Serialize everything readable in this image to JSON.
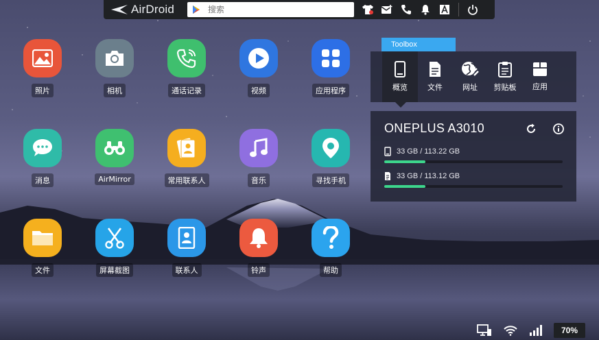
{
  "topbar": {
    "logo_text": "AirDroid",
    "search_placeholder": "搜索",
    "icons": [
      "tshirt-icon",
      "mail-icon",
      "phone-icon",
      "bell-icon",
      "font-icon",
      "power-icon"
    ]
  },
  "apps": [
    {
      "label": "照片",
      "icon": "photos-icon",
      "color": "#e8553a"
    },
    {
      "label": "相机",
      "icon": "camera-icon",
      "color": "#6b7f8c"
    },
    {
      "label": "通话记录",
      "icon": "call-log-icon",
      "color": "#3fbf6e"
    },
    {
      "label": "视频",
      "icon": "video-icon",
      "color": "#2f76e0"
    },
    {
      "label": "应用程序",
      "icon": "apps-icon",
      "color": "#2d6fe6"
    },
    {
      "label": "消息",
      "icon": "message-icon",
      "color": "#2fbba8"
    },
    {
      "label": "AirMirror",
      "icon": "binoculars-icon",
      "color": "#3fc070"
    },
    {
      "label": "常用联系人",
      "icon": "frequent-contacts-icon",
      "color": "#f5ae1f"
    },
    {
      "label": "音乐",
      "icon": "music-icon",
      "color": "#8f6fe0"
    },
    {
      "label": "寻找手机",
      "icon": "location-pin-icon",
      "color": "#26b7b0"
    },
    {
      "label": "文件",
      "icon": "folder-icon",
      "color": "#f5b01e"
    },
    {
      "label": "屏幕截图",
      "icon": "scissors-icon",
      "color": "#26a4e8"
    },
    {
      "label": "联系人",
      "icon": "contacts-icon",
      "color": "#2b97e8"
    },
    {
      "label": "铃声",
      "icon": "ringtone-bell-icon",
      "color": "#ec5a3f"
    },
    {
      "label": "帮助",
      "icon": "help-icon",
      "color": "#2ba4ee"
    }
  ],
  "toolbox": {
    "tab_label": "Toolbox",
    "items": [
      {
        "label": "概览",
        "icon": "phone-overview-icon",
        "active": true
      },
      {
        "label": "文件",
        "icon": "file-icon",
        "active": false
      },
      {
        "label": "网址",
        "icon": "globe-link-icon",
        "active": false
      },
      {
        "label": "剪贴板",
        "icon": "clipboard-icon",
        "active": false
      },
      {
        "label": "应用",
        "icon": "app-box-icon",
        "active": false
      }
    ]
  },
  "device": {
    "name": "ONEPLUS A3010",
    "storage": [
      {
        "text": "33 GB / 113.22 GB",
        "icon": "phone-storage-icon",
        "fill_fraction": 0.23
      },
      {
        "text": "33 GB / 113.12 GB",
        "icon": "sd-card-icon",
        "fill_fraction": 0.23
      }
    ]
  },
  "status": {
    "battery": "70%"
  },
  "colors": {
    "accent": "#3aa8f0",
    "storage_bar": "#3dd68c",
    "topbar": "#1f2124"
  }
}
